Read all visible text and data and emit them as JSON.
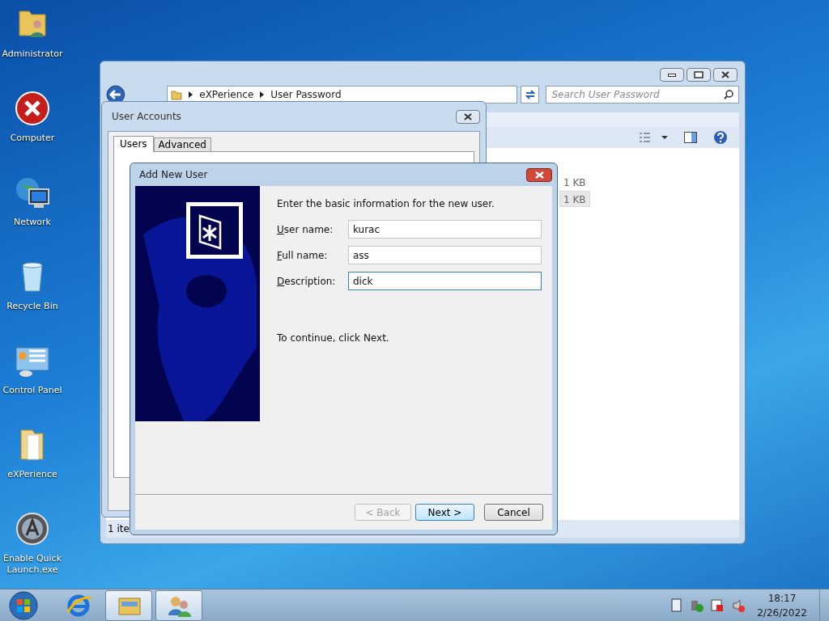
{
  "desktop_icons": [
    {
      "label": "Administrator",
      "kind": "userfolder"
    },
    {
      "label": "Computer",
      "kind": "error"
    },
    {
      "label": "Network",
      "kind": "network"
    },
    {
      "label": "Recycle Bin",
      "kind": "bin"
    },
    {
      "label": "Control Panel",
      "kind": "panel"
    },
    {
      "label": "eXPerience",
      "kind": "folder"
    },
    {
      "label": "Enable Quick Launch.exe",
      "kind": "app"
    }
  ],
  "explorer": {
    "breadcrumb": [
      "eXPerience",
      "User Password"
    ],
    "search": {
      "placeholder": "Search User Password"
    },
    "file_sizes": [
      {
        "text": "1 KB",
        "selected": false
      },
      {
        "text": "1 KB",
        "selected": true
      }
    ],
    "status": "1 ite"
  },
  "user_accounts": {
    "title": "User Accounts",
    "tabs": [
      {
        "label": "Users",
        "selected": true
      },
      {
        "label": "Advanced",
        "selected": false
      }
    ]
  },
  "add_user": {
    "title": "Add New User",
    "intro": "Enter the basic information for the new user.",
    "fields": [
      {
        "label": "User name:",
        "value": "kurac",
        "focused": false
      },
      {
        "label": "Full name:",
        "value": "ass",
        "focused": false
      },
      {
        "label": "Description:",
        "value": "dick",
        "focused": true
      }
    ],
    "footer": "To continue, click Next.",
    "buttons": [
      {
        "label": "< Back",
        "disabled": true,
        "default": false
      },
      {
        "label": "Next >",
        "disabled": false,
        "default": true
      },
      {
        "label": "Cancel",
        "disabled": false,
        "default": false
      }
    ]
  },
  "taskbar": {
    "items": [
      {
        "kind": "ie",
        "active": false
      },
      {
        "kind": "explorer",
        "active": true
      },
      {
        "kind": "users",
        "active": true
      }
    ],
    "time": "18:17",
    "date": "2/26/2022"
  }
}
